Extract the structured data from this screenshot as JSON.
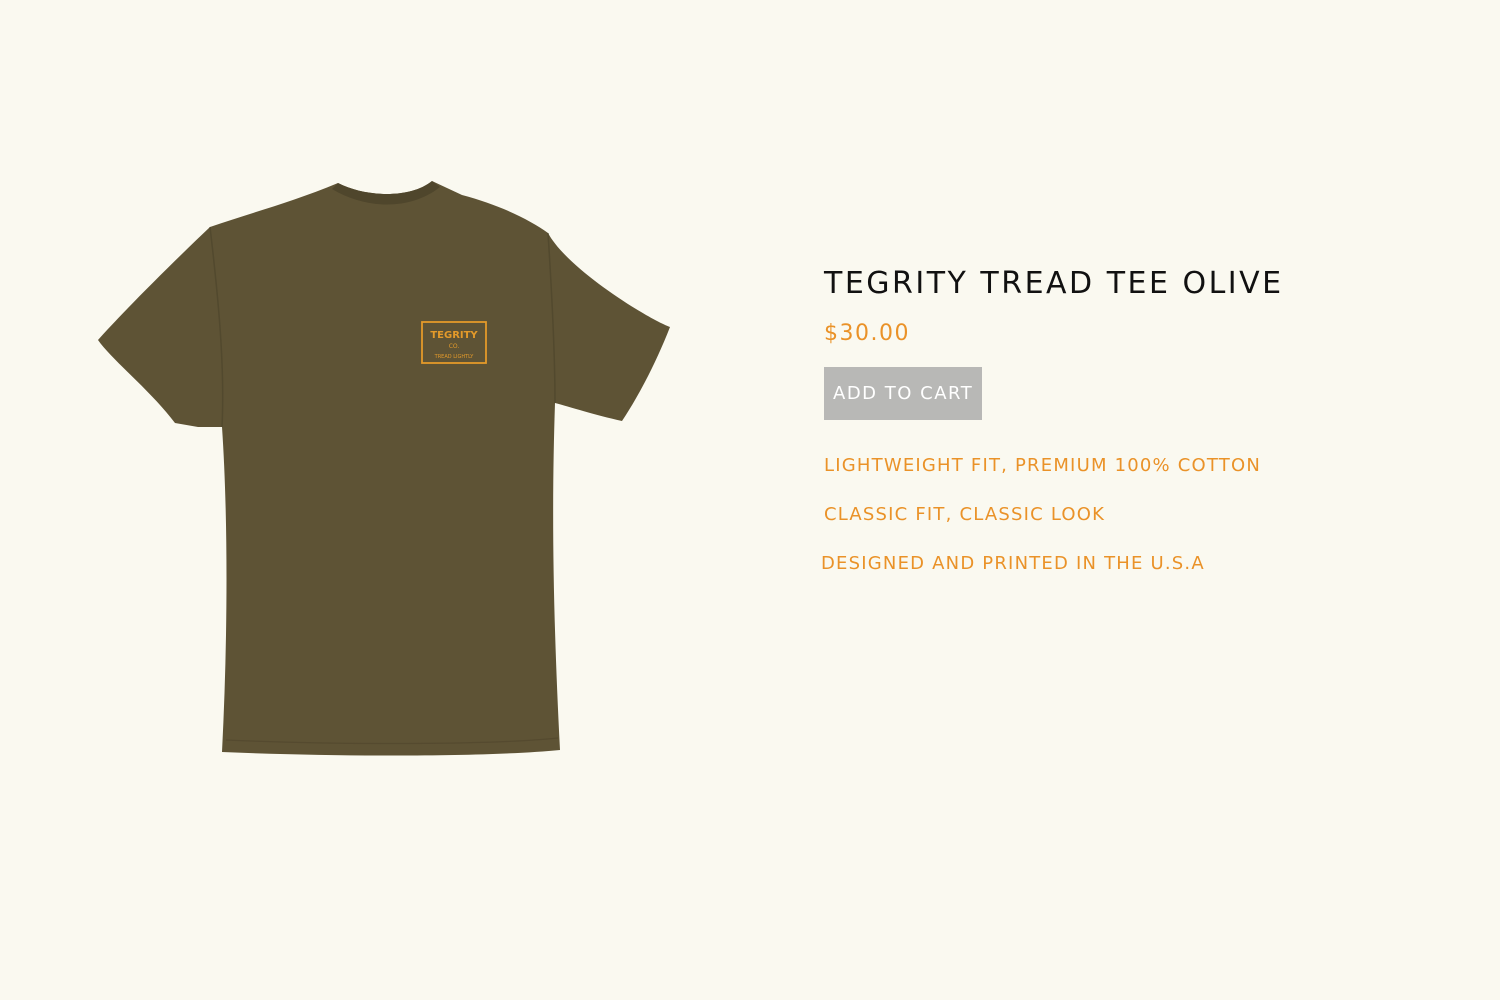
{
  "product": {
    "title": "TEGRITY TREAD TEE OLIVE",
    "price": "$30.00",
    "add_to_cart_label": "ADD TO CART",
    "image": {
      "garment_color": "#5e5335",
      "print_color": "#e39a2a",
      "print_text": {
        "line1": "TEGRITY",
        "line2": "CO.",
        "line3": "TREAD LIGHTLY"
      }
    },
    "features": [
      "LIGHTWEIGHT FIT, PREMIUM 100% COTTON",
      "CLASSIC FIT, CLASSIC LOOK",
      "DESIGNED AND PRINTED IN THE U.S.A"
    ]
  },
  "colors": {
    "background": "#faf9f0",
    "accent": "#ea9228",
    "button": "#b8b8b6",
    "title": "#111111"
  }
}
